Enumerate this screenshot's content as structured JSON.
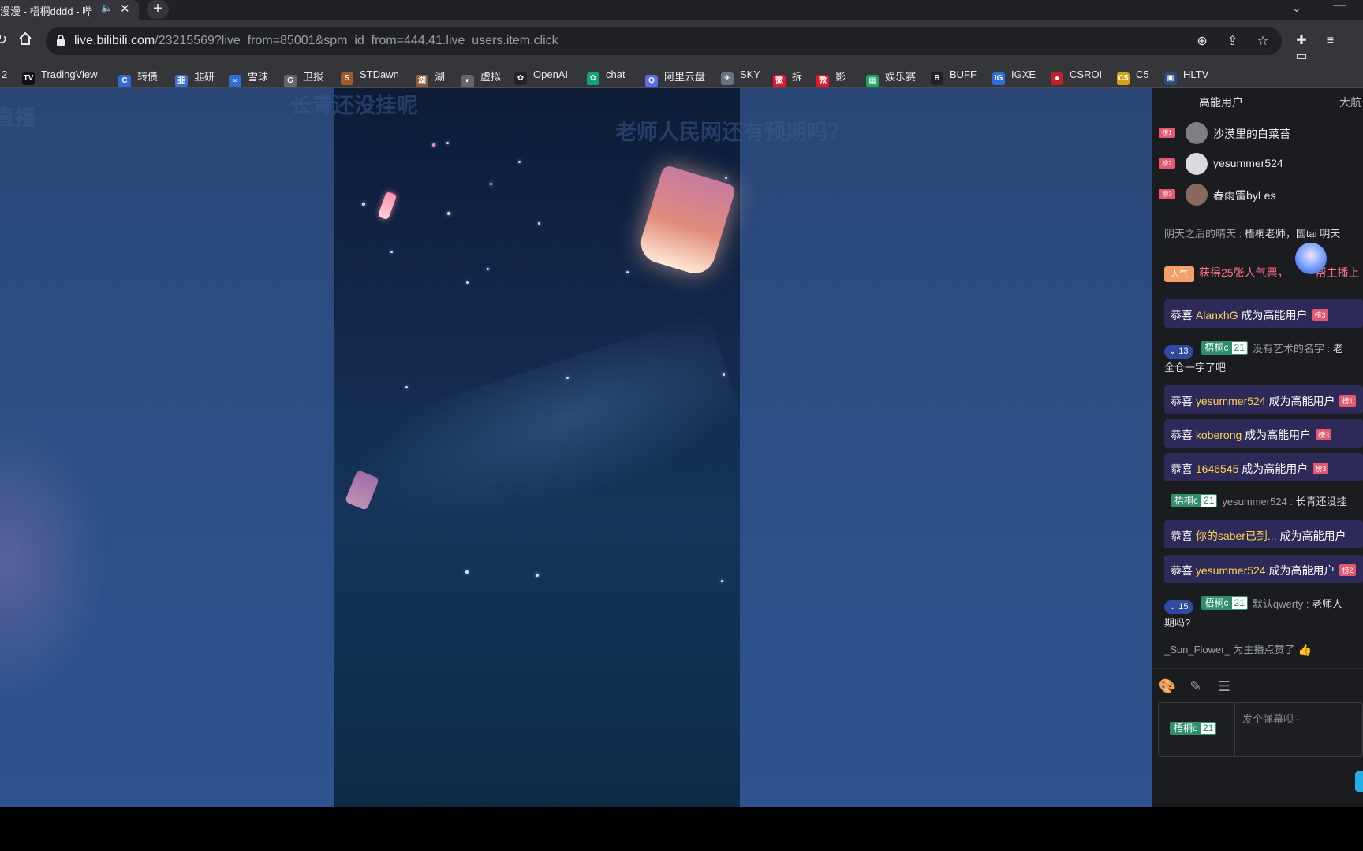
{
  "browser": {
    "tab_title": "漫漫 - 梧桐dddd - 哔",
    "url_host": "live.bilibili.com",
    "url_path": "/23215569?live_from=85001&spm_id_from=444.41.live_users.item.click"
  },
  "bookmarks": [
    {
      "label": "TradingView",
      "icon": "tradingview-icon",
      "color": "#111111",
      "glyph": "TV"
    },
    {
      "label": "转债",
      "icon": "convertible-icon",
      "color": "#2f6bd8",
      "glyph": "C"
    },
    {
      "label": "韭研",
      "icon": "jiuyan-icon",
      "color": "#3b6fd0",
      "glyph": "韭"
    },
    {
      "label": "雪球",
      "icon": "xueqiu-icon",
      "color": "#2c6fd9",
      "glyph": "∞"
    },
    {
      "label": "卫报",
      "icon": "guardian-icon",
      "color": "#666666",
      "glyph": "G"
    },
    {
      "label": "STDawn",
      "icon": "stdawn-icon",
      "color": "#a05a2c",
      "glyph": "S"
    },
    {
      "label": "湖",
      "icon": "lake-icon",
      "color": "#8b5a3c",
      "glyph": "湖"
    },
    {
      "label": "虚拟",
      "icon": "globe-icon",
      "color": "#666666",
      "glyph": "◐"
    },
    {
      "label": "OpenAI",
      "icon": "openai-icon",
      "color": "#222222",
      "glyph": "✿"
    },
    {
      "label": "chat",
      "icon": "chat-icon",
      "color": "#10a37f",
      "glyph": "✿"
    },
    {
      "label": "阿里云盘",
      "icon": "aliyun-drive-icon",
      "color": "#5b6bf0",
      "glyph": "Q"
    },
    {
      "label": "SKY",
      "icon": "sky-icon",
      "color": "#6b7280",
      "glyph": "✈"
    },
    {
      "label": "拆",
      "icon": "weibo-icon",
      "color": "#e6162d",
      "glyph": "微"
    },
    {
      "label": "影",
      "icon": "weibo-icon-2",
      "color": "#e6162d",
      "glyph": "微"
    },
    {
      "label": "娱乐赛",
      "icon": "sheet-icon",
      "color": "#1fa463",
      "glyph": "▦"
    },
    {
      "label": "BUFF",
      "icon": "buff-icon",
      "color": "#222222",
      "glyph": "B"
    },
    {
      "label": "IGXE",
      "icon": "igxe-icon",
      "color": "#2d6de0",
      "glyph": "IG"
    },
    {
      "label": "CSROI",
      "icon": "csroi-icon",
      "color": "#c0202a",
      "glyph": "●"
    },
    {
      "label": "C5",
      "icon": "c5-icon",
      "color": "#d4a017",
      "glyph": "C5"
    },
    {
      "label": "HLTV",
      "icon": "hltv-icon",
      "color": "#2d4a7a",
      "glyph": "▣"
    }
  ],
  "bookmark_prefix": "2",
  "video": {
    "danmaku": [
      {
        "text": "直播"
      },
      {
        "text": "长青还没挂呢"
      },
      {
        "text": "老师人民网还有预期吗？"
      }
    ]
  },
  "panel": {
    "tab_high_energy": "高能用户",
    "tab_captain": "大航",
    "high_energy_users": [
      {
        "rank": "榜1",
        "name": "沙漠里的白菜苔"
      },
      {
        "rank": "榜2",
        "name": "yesummer524"
      },
      {
        "rank": "榜3",
        "name": "春雨雷byLes"
      }
    ],
    "messages": {
      "m1_user": "阴天之后的晴天",
      "m1_text": "梧桐老师，国tai 明天",
      "gift_badge": "人气",
      "gift_text": "获得25张人气票，",
      "gift_text2": "帮主播上",
      "g1_prefix": "恭喜",
      "g1_user": "AlanxhG",
      "g1_suffix": "成为高能用户",
      "g1_lvl": "榜3",
      "m2_vote": "13",
      "medal_name": "梧桐c",
      "medal_level": "21",
      "m2_user": "没有艺术的名字",
      "m2_text": "老",
      "m2_line2": "全仓一字了吧",
      "g2_user": "yesummer524",
      "g2_lvl": "榜1",
      "g3_user": "koberong",
      "g3_lvl": "榜3",
      "g4_user": "1646545",
      "g4_lvl": "榜3",
      "m3_user": "yesummer524",
      "m3_text": "长青还没挂",
      "g5_user": "你的saber已到...",
      "g6_user": "yesummer524",
      "g6_lvl": "榜2",
      "m4_vote": "15",
      "m4_user": "默认qwerty",
      "m4_text": "老师人",
      "m4_line2": "期吗?",
      "like_text": "_Sun_Flower_ 为主播点赞了"
    },
    "input_placeholder": "发个弹幕呗~"
  },
  "colors": {
    "guard_bg": "#2d2a5a",
    "medal_green": "#2f8f6a",
    "rank_pink": "#e5586f",
    "send_blue": "#23ade5"
  }
}
